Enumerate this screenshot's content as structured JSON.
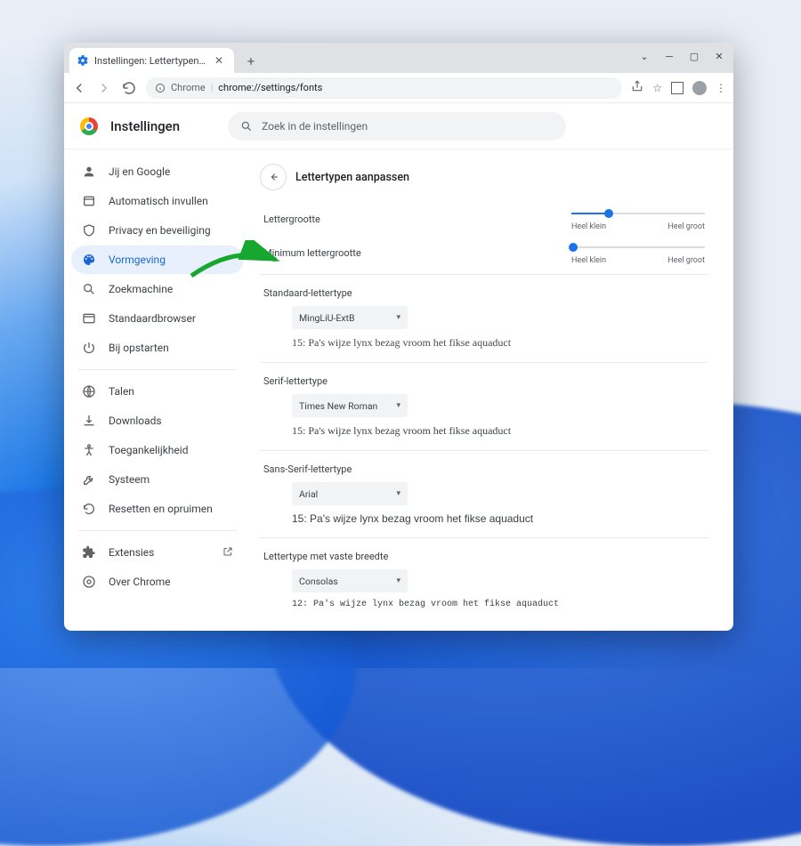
{
  "titlebar": {
    "tab_title": "Instellingen: Lettertypen aanpas…"
  },
  "toolbar": {
    "url_prefix": "Chrome",
    "url_path": "chrome://settings/fonts"
  },
  "header": {
    "app_title": "Instellingen",
    "search_placeholder": "Zoek in de instellingen"
  },
  "sidebar": {
    "items": [
      {
        "label": "Jij en Google"
      },
      {
        "label": "Automatisch invullen"
      },
      {
        "label": "Privacy en beveiliging"
      },
      {
        "label": "Vormgeving"
      },
      {
        "label": "Zoekmachine"
      },
      {
        "label": "Standaardbrowser"
      },
      {
        "label": "Bij opstarten"
      },
      {
        "label": "Talen"
      },
      {
        "label": "Downloads"
      },
      {
        "label": "Toegankelijkheid"
      },
      {
        "label": "Systeem"
      },
      {
        "label": "Resetten en opruimen"
      },
      {
        "label": "Extensies"
      },
      {
        "label": "Over Chrome"
      }
    ]
  },
  "page": {
    "title": "Lettertypen aanpassen",
    "font_size_label": "Lettergrootte",
    "min_font_size_label": "Minimum lettergrootte",
    "slider_min": "Heel klein",
    "slider_max": "Heel groot",
    "sections": {
      "standard": {
        "label": "Standaard-lettertype",
        "value": "MingLiU-ExtB",
        "sample": "15: Pa's wijze lynx bezag vroom het fikse aquaduct"
      },
      "serif": {
        "label": "Serif-lettertype",
        "value": "Times New Roman",
        "sample": "15: Pa's wijze lynx bezag vroom het fikse aquaduct"
      },
      "sans": {
        "label": "Sans-Serif-lettertype",
        "value": "Arial",
        "sample": "15: Pa's wijze lynx bezag vroom het fikse aquaduct"
      },
      "fixed": {
        "label": "Lettertype met vaste breedte",
        "value": "Consolas",
        "sample": "12: Pa's wijze lynx bezag vroom het fikse aquaduct"
      }
    }
  }
}
